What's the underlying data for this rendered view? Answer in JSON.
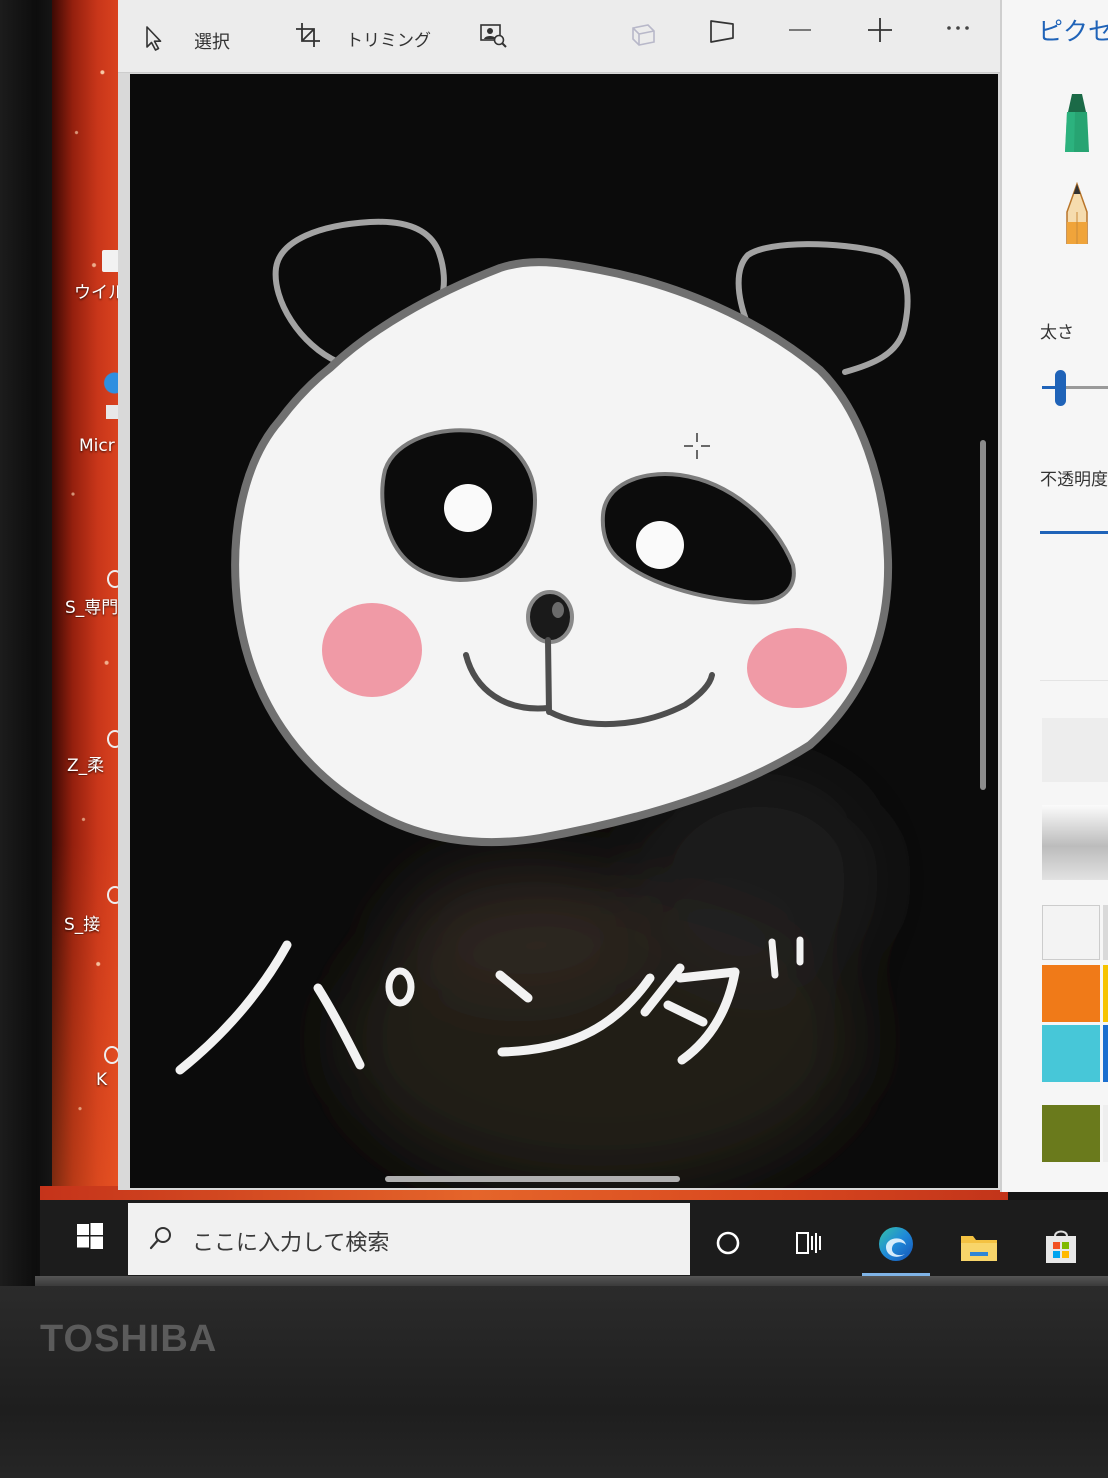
{
  "desktop": {
    "icon_labels": [
      "ウイル",
      "Micr",
      "S_専門",
      "Z_柔",
      "S_接",
      "K"
    ]
  },
  "paint": {
    "toolbar": {
      "select_label": "選択",
      "crop_label": "トリミング",
      "icons": [
        "select-arrow-icon",
        "crop-icon",
        "magic-select-icon",
        "mixed-reality-icon",
        "3d-view-icon",
        "zoom-out-icon",
        "zoom-in-icon",
        "more-icon"
      ]
    },
    "canvas": {
      "background_color": "#0b0b0b",
      "handwritten_caption": "パンダ"
    },
    "side_panel": {
      "tool_title": "ピクセ",
      "brush_icons": [
        "marker-icon",
        "pencil-icon"
      ],
      "thickness_label": "太さ",
      "opacity_label": "不透明度",
      "accent_color": "#1f63b8",
      "swatches": [
        "#f3f3f3",
        "#d9d9d9",
        "#f07a18",
        "#f6c300",
        "#47c7d8",
        "#1b6fd0",
        "#6a7a1c",
        "#eeeeee"
      ]
    }
  },
  "taskbar": {
    "search_placeholder": "ここに入力して検索",
    "icons": [
      "windows-start-icon",
      "search-icon",
      "cortana-icon",
      "task-view-icon",
      "edge-icon",
      "file-explorer-icon",
      "store-icon"
    ],
    "active_app": "edge-icon"
  },
  "device": {
    "logo": "TOSHIBA"
  }
}
